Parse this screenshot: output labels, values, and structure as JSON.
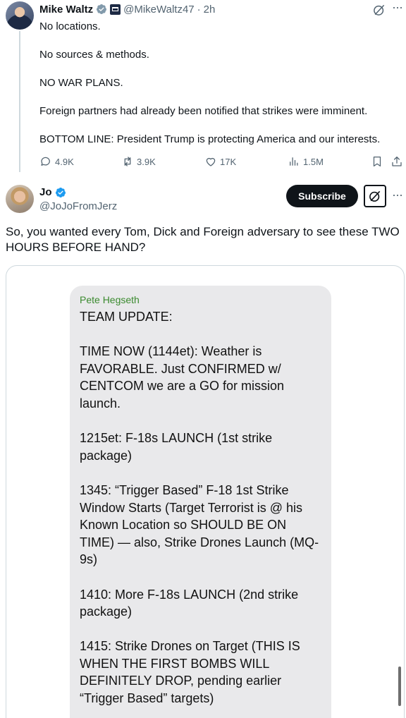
{
  "tweet1": {
    "author_name": "Mike Waltz",
    "handle": "@MikeWaltz47",
    "time": "2h",
    "lines": [
      "No locations.",
      "No sources & methods.",
      "NO WAR PLANS.",
      "Foreign partners had already been notified that strikes were imminent.",
      "BOTTOM LINE:  President Trump is protecting America and our interests."
    ],
    "stats": {
      "replies": "4.9K",
      "reposts": "3.9K",
      "likes": "17K",
      "views": "1.5M"
    }
  },
  "tweet2": {
    "author_name": "Jo",
    "handle": "@JoJoFromJerz",
    "subscribe_label": "Subscribe",
    "text": "So, you wanted every Tom, Dick and Foreign adversary to see these TWO HOURS BEFORE HAND?",
    "media": {
      "sender": "Pete Hegseth",
      "paragraphs": [
        "TEAM UPDATE:",
        "TIME NOW (1144et): Weather is FAVORABLE. Just CONFIRMED w/ CENTCOM we are a GO for mission launch.",
        "1215et: F-18s LAUNCH (1st strike package)",
        "1345: “Trigger Based” F-18 1st Strike Window Starts (Target Terrorist is @ his Known Location so SHOULD BE ON TIME) — also, Strike Drones Launch (MQ-9s)",
        "1410: More F-18s LAUNCH (2nd strike package)",
        "1415: Strike Drones on Target (THIS IS WHEN THE FIRST BOMBS WILL DEFINITELY DROP, pending earlier “Trigger Based” targets)"
      ]
    }
  },
  "icons": {
    "verified": "verified-badge-icon",
    "gov": "government-badge-icon",
    "grok": "grok-icon",
    "more": "more-options-icon",
    "reply": "reply-icon",
    "repost": "repost-icon",
    "like": "like-icon",
    "views": "views-icon",
    "bookmark": "bookmark-icon",
    "share": "share-icon"
  },
  "colors": {
    "text": "#0f1419",
    "secondary": "#536471",
    "verified_blue": "#1d9bf0",
    "sender_green": "#3a8a2e",
    "bubble_gray": "#e9e9eb"
  }
}
